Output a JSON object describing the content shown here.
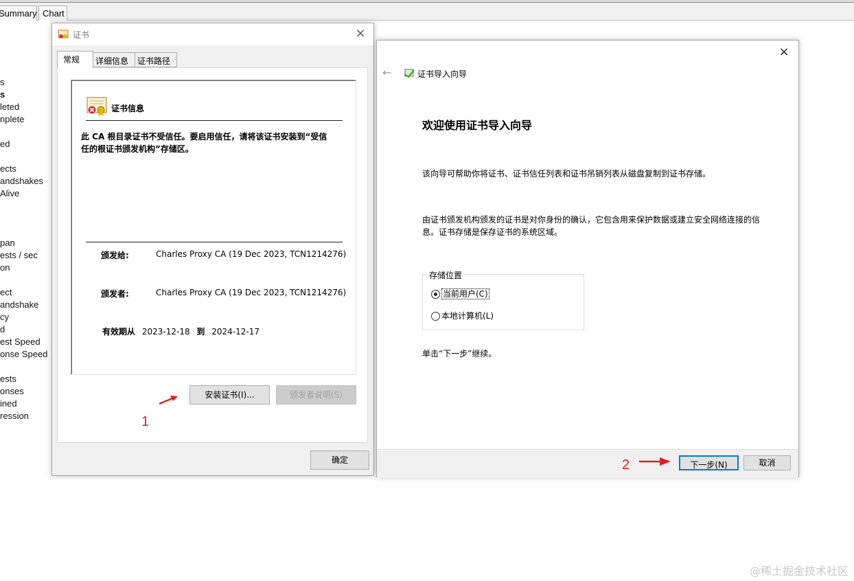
{
  "background": {
    "tabs": [
      "Summary",
      "Chart"
    ],
    "list_rows": [
      "s",
      "s",
      "leted",
      "nplete",
      "",
      "ed",
      "",
      "ects",
      "andshakes",
      "Alive",
      "",
      "",
      "pan",
      "ests / sec",
      "on",
      "",
      "ect",
      "andshake",
      "cy",
      "d",
      "est Speed",
      "onse Speed",
      "",
      "ests",
      "onses",
      "ined",
      "ression"
    ]
  },
  "cert_dialog": {
    "title": "证书",
    "close": "×",
    "tabs": [
      "常规",
      "详细信息",
      "证书路径"
    ],
    "info_title": "证书信息",
    "warning": "此 CA 根目录证书不受信任。要启用信任，请将该证书安装到“受信任的根证书颁发机构”存储区。",
    "issued_to_label": "颁发给:",
    "issued_to_value": "Charles Proxy CA (19 Dec 2023, TCN1214276)",
    "issued_by_label": "颁发者:",
    "issued_by_value": "Charles Proxy CA (19 Dec 2023, TCN1214276)",
    "valid_from_label": "有效期从",
    "valid_from": "2023-12-18",
    "valid_to_label": "到",
    "valid_to": "2024-12-17",
    "install_button": "安装证书(I)...",
    "issuer_statement_button": "颁发者说明(S)",
    "ok_button": "确定"
  },
  "wizard": {
    "close": "×",
    "back": "←",
    "header_title": "证书导入向导",
    "title": "欢迎使用证书导入向导",
    "para1": "该向导可帮助你将证书、证书信任列表和证书吊销列表从磁盘复制到证书存储。",
    "para2": "由证书颁发机构颁发的证书是对你身份的确认，它包含用来保护数据或建立安全网络连接的信息。证书存储是保存证书的系统区域。",
    "store_location_legend": "存储位置",
    "options": [
      {
        "label": "当前用户(C)",
        "checked": true
      },
      {
        "label": "本地计算机(L)",
        "checked": false
      }
    ],
    "continue_text": "单击“下一步”继续。",
    "next_button": "下一步(N)",
    "cancel_button": "取消"
  },
  "annotations": {
    "step1": "1",
    "step2": "2",
    "color": "#e02020"
  },
  "watermark": "@稀土掘金技术社区"
}
